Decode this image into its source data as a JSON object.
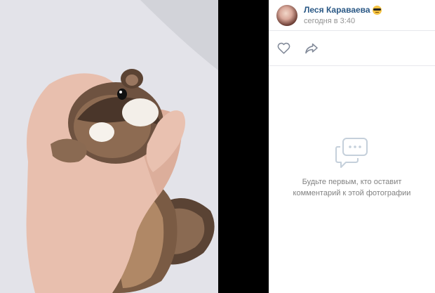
{
  "author": {
    "name": "Леся Караваева",
    "status_emoji": "sunglasses-emoji",
    "time": "сегодня в 3:40"
  },
  "actions": {
    "like_icon": "heart-icon",
    "share_icon": "share-arrow-icon"
  },
  "comments": {
    "empty_icon": "comments-icon",
    "empty_line1": "Будьте первым, кто оставит",
    "empty_line2": "комментарий к этой фотографии"
  },
  "photo": {
    "subject": "felted chipmunk toy in hand"
  },
  "colors": {
    "link": "#2a5885",
    "muted": "#939393",
    "divider": "#e7e8ec",
    "icon": "#828a99",
    "empty_icon": "#c5d0db"
  }
}
